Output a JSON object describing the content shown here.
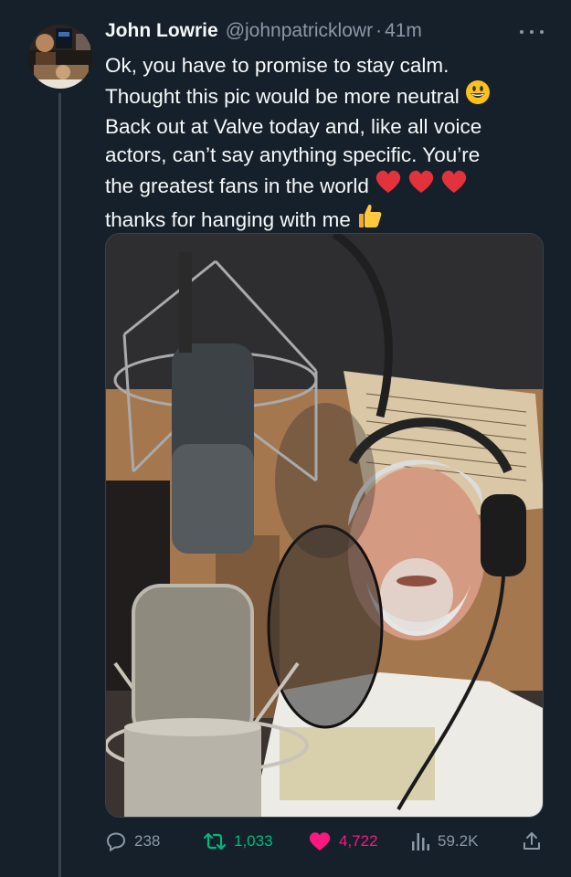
{
  "author": {
    "name": "John Lowrie",
    "handle": "@johnpatricklowr",
    "separator": "·",
    "time": "41m"
  },
  "tweet": {
    "lines": [
      "Ok, you have to promise to stay calm.",
      "Thought this pic would be more neutral",
      "Back out at Valve today and, like all voice",
      "actors, can’t say anything specific.  You’re",
      "the greatest fans in the world",
      "thanks for hanging with me"
    ],
    "emojis": {
      "line2": "grinning-face",
      "line5": [
        "red-heart",
        "red-heart",
        "red-heart"
      ],
      "line6": "thumbs-up"
    }
  },
  "actions": {
    "replies": "238",
    "retweets": "1,033",
    "likes": "4,722",
    "views": "59.2K"
  },
  "colors": {
    "background": "#15202b",
    "muted": "#8b98a5",
    "retweet_active": "#00ba7c",
    "like_active": "#f91880"
  },
  "icons": [
    "more-icon",
    "reply-icon",
    "retweet-icon",
    "like-icon",
    "views-icon",
    "share-icon"
  ]
}
